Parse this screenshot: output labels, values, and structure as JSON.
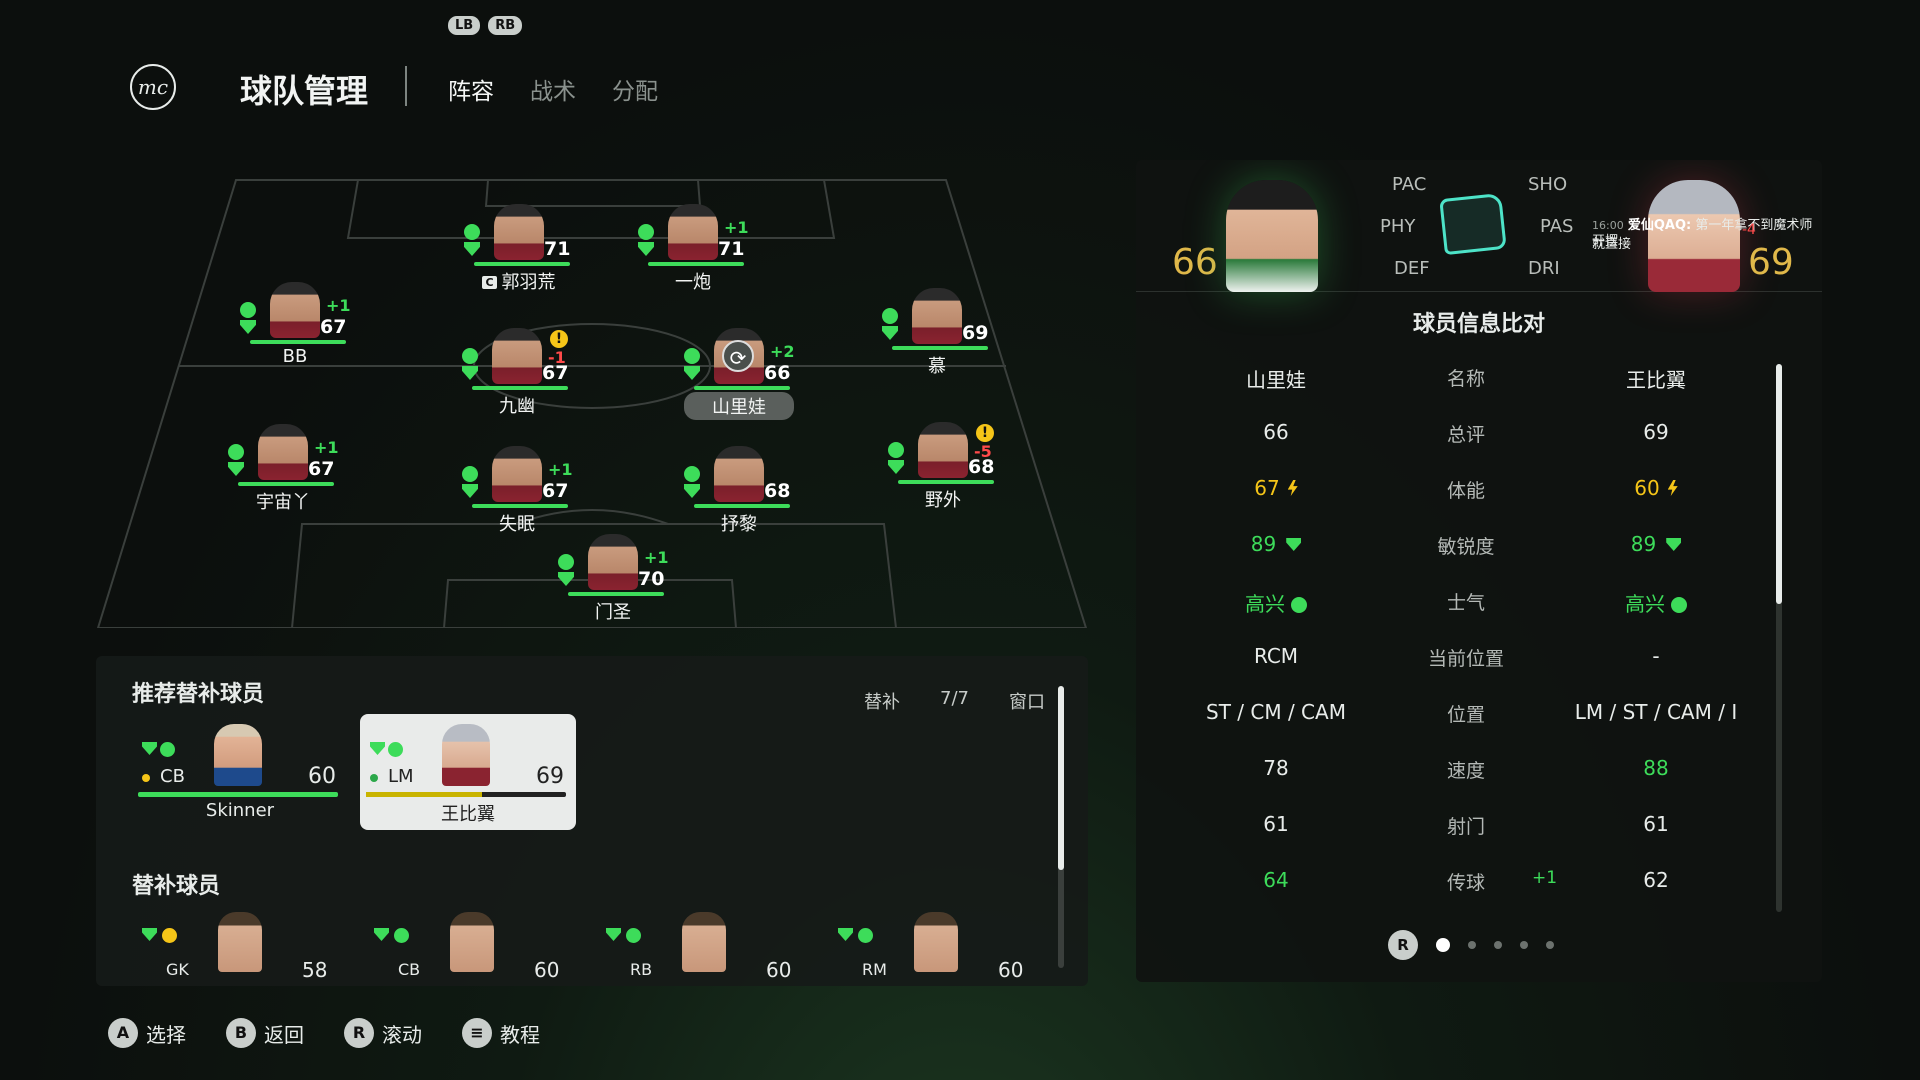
{
  "top": {
    "lb": "LB",
    "rb": "RB",
    "logo": "mc",
    "title": "球队管理",
    "tabs": [
      "阵容",
      "战术",
      "分配"
    ]
  },
  "pitch": {
    "players": [
      {
        "name": "郭羽荒",
        "ovr": "71",
        "delta": "",
        "captain": "C"
      },
      {
        "name": "一炮",
        "ovr": "71",
        "delta": "+1"
      },
      {
        "name": "BB",
        "ovr": "67",
        "delta": "+1"
      },
      {
        "name": "九幽",
        "ovr": "67",
        "delta": "-1",
        "warn": "!"
      },
      {
        "name": "山里娃",
        "ovr": "66",
        "delta": "+2"
      },
      {
        "name": "慕",
        "ovr": "69",
        "delta": ""
      },
      {
        "name": "宇宙丫",
        "ovr": "67",
        "delta": "+1"
      },
      {
        "name": "失眠",
        "ovr": "67",
        "delta": "+1"
      },
      {
        "name": "抒黎",
        "ovr": "68",
        "delta": ""
      },
      {
        "name": "野外",
        "ovr": "68",
        "delta": "-5",
        "warn": "!"
      },
      {
        "name": "门圣",
        "ovr": "70",
        "delta": "+1"
      }
    ]
  },
  "subs": {
    "recommended_title": "推荐替补球员",
    "meta": {
      "label": "替补",
      "count": "7/7",
      "window": "窗口"
    },
    "recommended": [
      {
        "pos": "CB",
        "ovr": "60",
        "name": "Skinner"
      },
      {
        "pos": "LM",
        "ovr": "69",
        "name": "王比翼"
      }
    ],
    "bench_title": "替补球员",
    "bench": [
      {
        "pos": "GK",
        "ovr": "58"
      },
      {
        "pos": "CB",
        "ovr": "60"
      },
      {
        "pos": "RB",
        "ovr": "60"
      },
      {
        "pos": "RM",
        "ovr": "60"
      }
    ]
  },
  "compare": {
    "left_ovr": "66",
    "right_ovr": "69",
    "attrs": {
      "pac": "PAC",
      "sho": "SHO",
      "phy": "PHY",
      "pas": "PAS",
      "def": "DEF",
      "dri": "DRI"
    },
    "chat": {
      "time": "16:00",
      "user": "爱仙QAQ:",
      "text": "第一年拿不到魔术师就直接",
      "text2": "开摆",
      "neg": "-4"
    },
    "title": "球员信息比对",
    "rows": [
      {
        "label": "名称",
        "left": "山里娃",
        "right": "王比翼"
      },
      {
        "label": "总评",
        "left": "66",
        "right": "69"
      },
      {
        "label": "体能",
        "left": "67",
        "right": "60"
      },
      {
        "label": "敏锐度",
        "left": "89",
        "right": "89"
      },
      {
        "label": "士气",
        "left": "高兴",
        "right": "高兴"
      },
      {
        "label": "当前位置",
        "left": "RCM",
        "right": "-"
      },
      {
        "label": "位置",
        "left": "ST / CM / CAM",
        "right": "LM / ST / CAM / I"
      },
      {
        "label": "速度",
        "left": "78",
        "right": "88"
      },
      {
        "label": "射门",
        "left": "61",
        "right": "61"
      },
      {
        "label": "传球",
        "left": "64",
        "right": "62",
        "diff": "+1"
      }
    ],
    "pager_btn": "R"
  },
  "hints": [
    {
      "btn": "A",
      "label": "选择"
    },
    {
      "btn": "B",
      "label": "返回"
    },
    {
      "btn": "R",
      "label": "滚动"
    },
    {
      "btn": "≡",
      "label": "教程"
    }
  ],
  "colors": {
    "accent_green": "#3ddc5a",
    "warn_yellow": "#f5c518",
    "neg_red": "#ff4a4a",
    "pitch_line": "#3a3f3c"
  }
}
